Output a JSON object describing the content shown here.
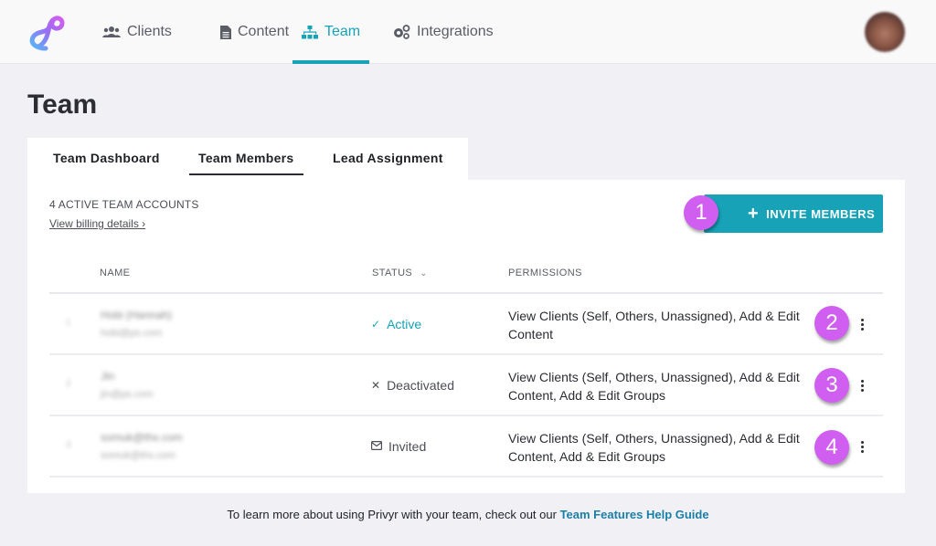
{
  "nav": {
    "items": [
      {
        "label": "Clients",
        "icon": "users-icon",
        "active": false
      },
      {
        "label": "Content",
        "icon": "document-icon",
        "active": false
      },
      {
        "label": "Team",
        "icon": "sitemap-icon",
        "active": true
      },
      {
        "label": "Integrations",
        "icon": "cogs-icon",
        "active": false
      }
    ],
    "accent_color": "#17a2b8"
  },
  "page": {
    "title": "Team"
  },
  "tabs": [
    {
      "label": "Team Dashboard",
      "active": false
    },
    {
      "label": "Team Members",
      "active": true
    },
    {
      "label": "Lead Assignment",
      "active": false
    }
  ],
  "summary": {
    "accounts_count": "4 ACTIVE TEAM ACCOUNTS",
    "billing_link": "View billing details ›"
  },
  "invite_button": {
    "icon": "plus-icon",
    "label": "INVITE MEMBERS"
  },
  "table": {
    "columns": {
      "name": "NAME",
      "status": "STATUS",
      "permissions": "PERMISSIONS"
    },
    "rows": [
      {
        "num": "1",
        "name": "Hobi (Hannah)",
        "email": "hobi@ps.com",
        "status": "Active",
        "status_icon": "check-icon",
        "permissions": "View Clients (Self, Others, Unassigned), Add & Edit Content"
      },
      {
        "num": "2",
        "name": "Jin",
        "email": "jin@ps.com",
        "status": "Deactivated",
        "status_icon": "x-icon",
        "permissions": "View Clients (Self, Others, Unassigned), Add & Edit Content, Add & Edit Groups"
      },
      {
        "num": "3",
        "name": "somuk@thx.com",
        "email": "somuk@thx.com",
        "status": "Invited",
        "status_icon": "envelope-icon",
        "permissions": "View Clients (Self, Others, Unassigned), Add & Edit Content, Add & Edit Groups"
      }
    ]
  },
  "annotations": [
    "1",
    "2",
    "3",
    "4"
  ],
  "footer": {
    "text": "To learn more about using Privyr with your team, check out our ",
    "link": "Team Features Help Guide"
  }
}
